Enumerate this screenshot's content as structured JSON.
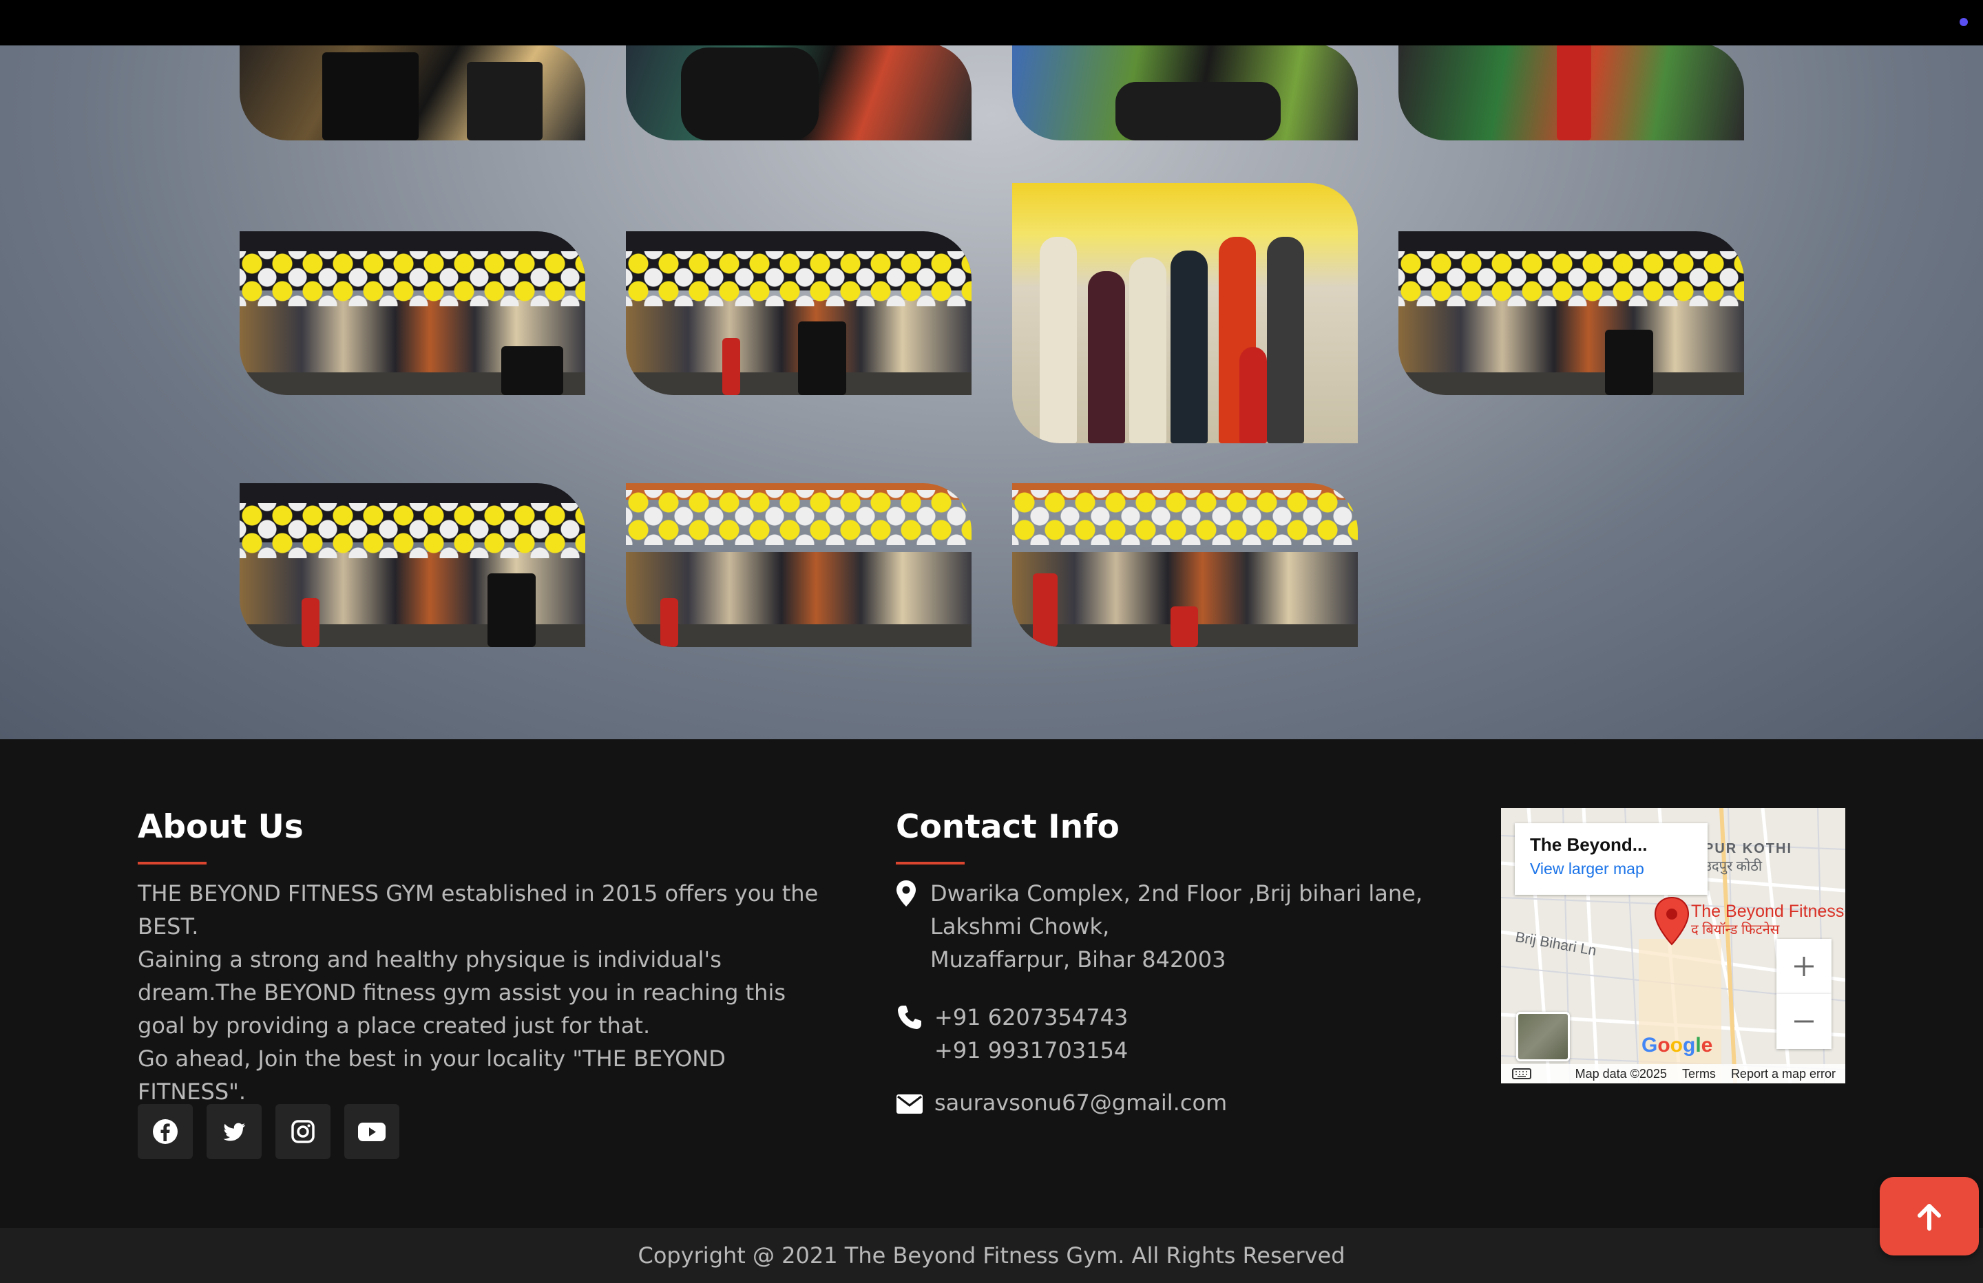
{
  "about": {
    "title": "About Us",
    "lines": [
      "THE BEYOND FITNESS GYM established in 2015 offers you the",
      "BEST.",
      "Gaining a strong and healthy physique is individual's",
      "dream.The BEYOND fitness gym assist you in reaching this",
      "goal by providing a place created just for that.",
      "Go ahead, Join the best in your locality \"THE BEYOND FITNESS\"."
    ],
    "social_icons": [
      "facebook-icon",
      "twitter-icon",
      "instagram-icon",
      "youtube-icon"
    ]
  },
  "contact": {
    "title": "Contact Info",
    "address_lines": [
      "Dwarika Complex, 2nd Floor ,Brij bihari lane,",
      "Lakshmi Chowk,",
      "Muzaffarpur, Bihar 842003"
    ],
    "phones": [
      "+91 6207354743",
      "+91 9931703154"
    ],
    "email": "sauravsonu67@gmail.com"
  },
  "map": {
    "place_name": "The Beyond...",
    "larger_map_link": "View larger map",
    "pin_label": "The Beyond Fitness",
    "pin_label_hindi": "द बियॉन्ड फिटनेस",
    "road_label": "Brij Bihari Ln",
    "area_label": "PUR KOTHI",
    "area_label_hindi": "उदपुर कोठी",
    "google": "Google",
    "map_data": "Map data ©2025",
    "terms": "Terms",
    "report": "Report a map error"
  },
  "copyright": "Copyright @ 2021 The Beyond Fitness Gym. All Rights Reserved",
  "colors": {
    "accent": "#d9452f",
    "to_top": "#e94a3a",
    "footer_bg": "#131313"
  }
}
